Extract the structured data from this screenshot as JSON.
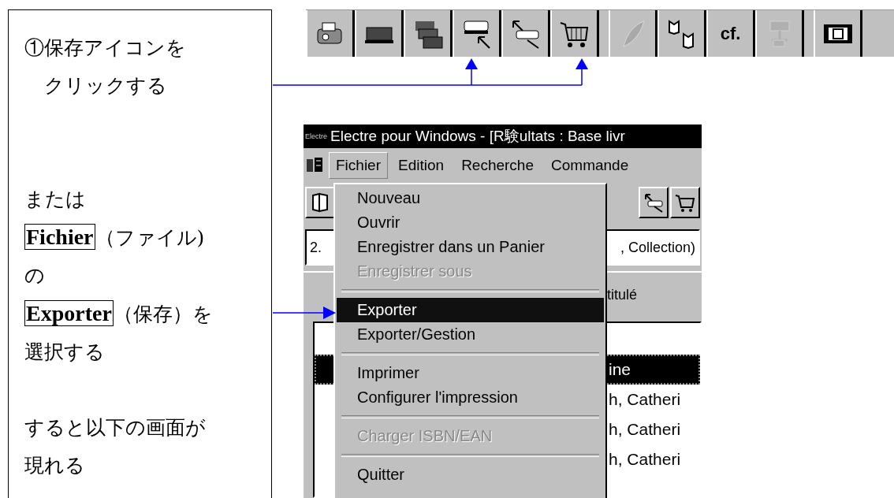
{
  "instructions": {
    "paragraphs": [
      [
        "①保存アイコンを",
        "　クリックする"
      ],
      [
        "または",
        "**Fichier**（ファイル)",
        "の",
        "**Exporter**（保存）を",
        "選択する"
      ],
      [
        "すると以下の画面が",
        "現れる"
      ]
    ]
  },
  "toolbar": {
    "groups": [
      [
        {
          "disabled": false
        },
        {
          "disabled": false
        },
        {
          "disabled": false
        },
        {
          "disabled": false
        },
        {
          "disabled": false
        },
        {
          "disabled": false
        }
      ],
      [
        {
          "disabled": true
        },
        {
          "disabled": false
        },
        {
          "label": "cf.",
          "disabled": false
        },
        {
          "disabled": true
        }
      ],
      [
        {
          "disabled": false
        }
      ]
    ]
  },
  "window": {
    "logo": "Electre",
    "title": "Electre pour Windows - [R験ultats : Base livr",
    "menubar": [
      {
        "label": "Fichier",
        "selected": true
      },
      {
        "label": "Edition",
        "selected": false
      },
      {
        "label": "Recherche",
        "selected": false
      },
      {
        "label": "Commande",
        "selected": false
      }
    ],
    "field": {
      "value": "2.",
      "value_right": ", Collection)"
    },
    "header": "titulé",
    "rows": [
      {
        "text": "ine",
        "selected": true
      },
      {
        "text": "h, Catheri",
        "selected": false
      },
      {
        "text": "h, Catheri",
        "selected": false
      },
      {
        "text": "h, Catheri",
        "selected": false
      }
    ],
    "menu": [
      {
        "kind": "item",
        "label": "Nouveau",
        "disabled": false,
        "selected": false
      },
      {
        "kind": "item",
        "label": "Ouvrir",
        "disabled": false,
        "selected": false
      },
      {
        "kind": "item",
        "label": "Enregistrer dans un Panier",
        "disabled": false,
        "selected": false
      },
      {
        "kind": "item",
        "label": "Enregistrer sous",
        "disabled": true,
        "selected": false
      },
      {
        "kind": "separator"
      },
      {
        "kind": "item",
        "label": "Exporter",
        "disabled": false,
        "selected": true
      },
      {
        "kind": "item",
        "label": "Exporter/Gestion",
        "disabled": false,
        "selected": false
      },
      {
        "kind": "separator"
      },
      {
        "kind": "item",
        "label": "Imprimer",
        "disabled": false,
        "selected": false
      },
      {
        "kind": "item",
        "label": "Configurer l'impression",
        "disabled": false,
        "selected": false
      },
      {
        "kind": "separator"
      },
      {
        "kind": "item",
        "label": "Charger ISBN/EAN",
        "disabled": true,
        "selected": false
      },
      {
        "kind": "separator"
      },
      {
        "kind": "item",
        "label": "Quitter",
        "disabled": false,
        "selected": false
      }
    ]
  }
}
